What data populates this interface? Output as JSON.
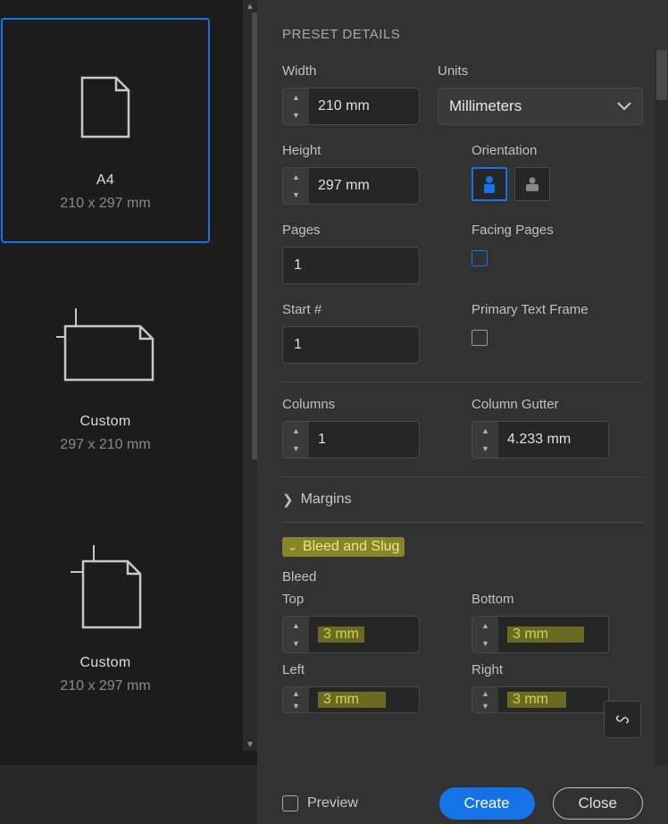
{
  "presets": [
    {
      "title": "A4",
      "dims": "210 x 297 mm"
    },
    {
      "title": "Custom",
      "dims": "297 x 210 mm"
    },
    {
      "title": "Custom",
      "dims": "210 x 297 mm"
    }
  ],
  "panel": {
    "title": "PRESET DETAILS",
    "width_label": "Width",
    "width_value": "210 mm",
    "units_label": "Units",
    "units_value": "Millimeters",
    "height_label": "Height",
    "height_value": "297 mm",
    "orientation_label": "Orientation",
    "pages_label": "Pages",
    "pages_value": "1",
    "facing_label": "Facing Pages",
    "start_label": "Start #",
    "start_value": "1",
    "ptf_label": "Primary Text Frame",
    "columns_label": "Columns",
    "columns_value": "1",
    "gutter_label": "Column Gutter",
    "gutter_value": "4.233 mm",
    "margins_label": "Margins",
    "bleedslug_label": "Bleed and Slug",
    "bleed_label": "Bleed",
    "top_label": "Top",
    "bottom_label": "Bottom",
    "left_label": "Left",
    "right_label": "Right",
    "bleed_top": "3 mm",
    "bleed_bottom": "3 mm",
    "bleed_left": "3 mm",
    "bleed_right": "3 mm",
    "preview_label": "Preview",
    "create_label": "Create",
    "close_label": "Close"
  }
}
